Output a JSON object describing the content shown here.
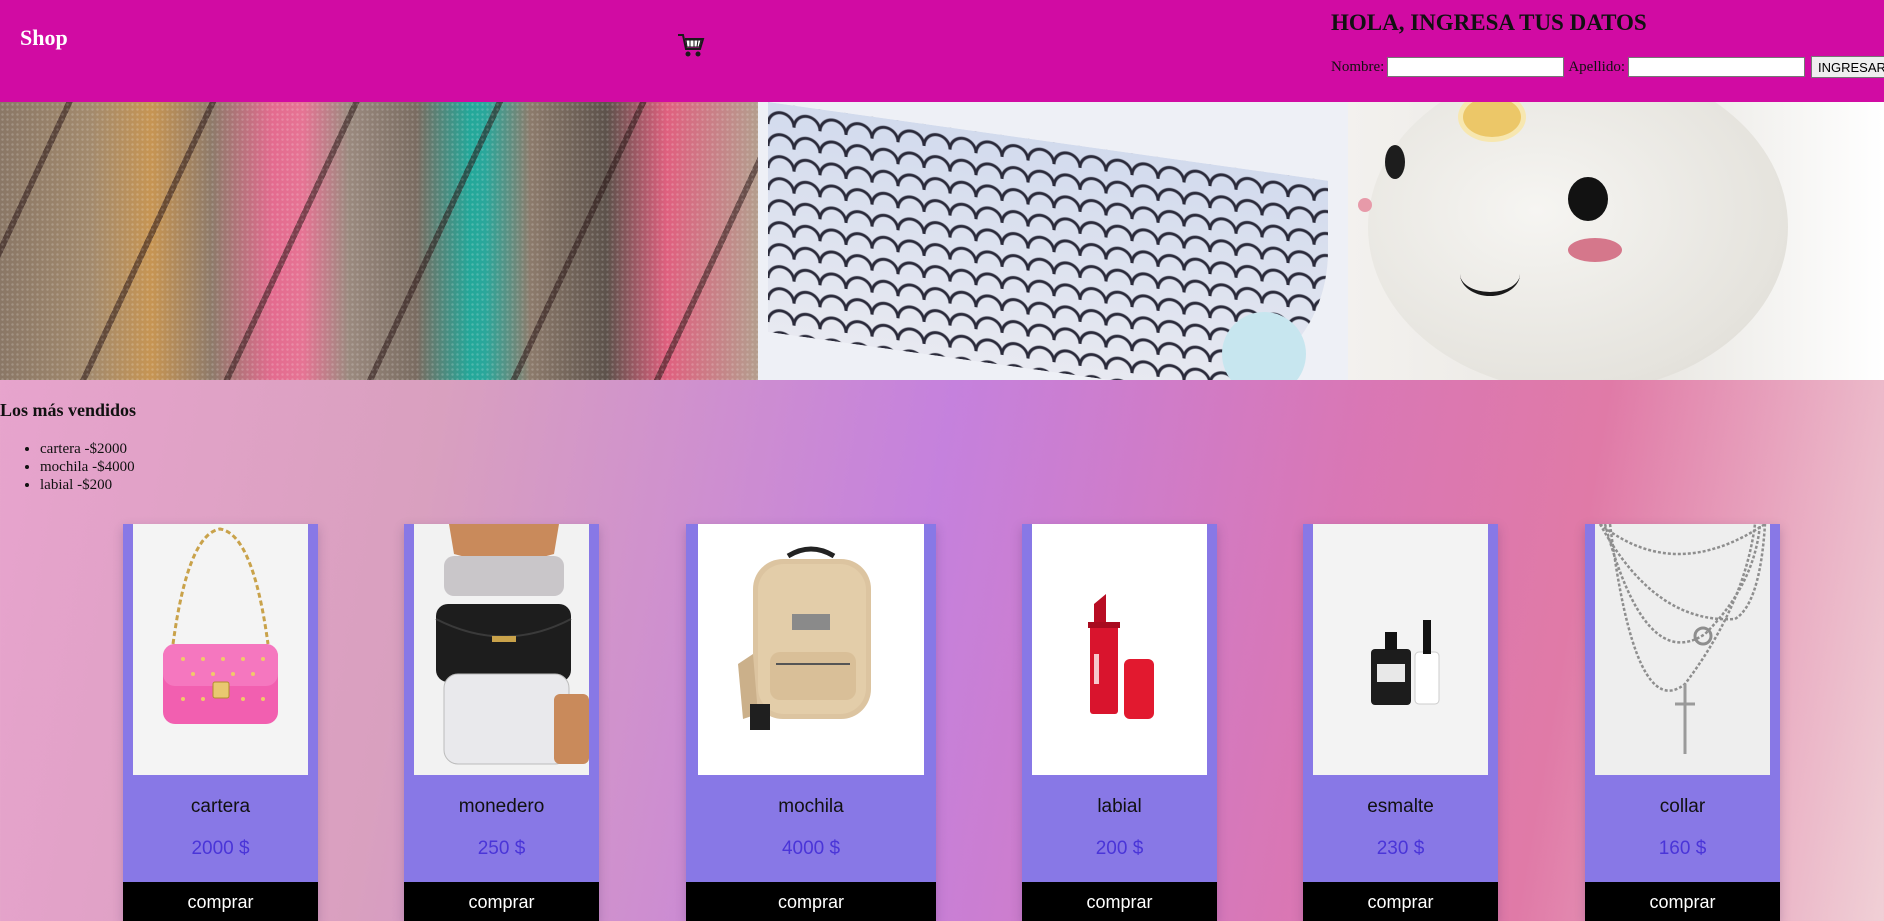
{
  "header": {
    "brand": "Shop",
    "cart_icon": "shopping-cart-icon",
    "greeting": "HOLA, INGRESA TUS DATOS",
    "form": {
      "nombre_label": "Nombre:",
      "nombre_value": "",
      "apellido_label": "Apellido:",
      "apellido_value": "",
      "submit_label": "INGRESAR"
    }
  },
  "best_sellers": {
    "title": "Los más vendidos",
    "items": [
      "cartera -$2000",
      "mochila -$4000",
      "labial -$200"
    ]
  },
  "products": [
    {
      "name": "cartera",
      "price": "2000 $",
      "button": "comprar"
    },
    {
      "name": "monedero",
      "price": "250 $",
      "button": "comprar"
    },
    {
      "name": "mochila",
      "price": "4000 $",
      "button": "comprar"
    },
    {
      "name": "labial",
      "price": "200 $",
      "button": "comprar"
    },
    {
      "name": "esmalte",
      "price": "230 $",
      "button": "comprar"
    },
    {
      "name": "collar",
      "price": "160 $",
      "button": "comprar"
    }
  ],
  "colors": {
    "header_bg": "#d10ba3",
    "card_bg": "#8878e6",
    "price": "#4a35d8",
    "buy_bg": "#000000"
  }
}
